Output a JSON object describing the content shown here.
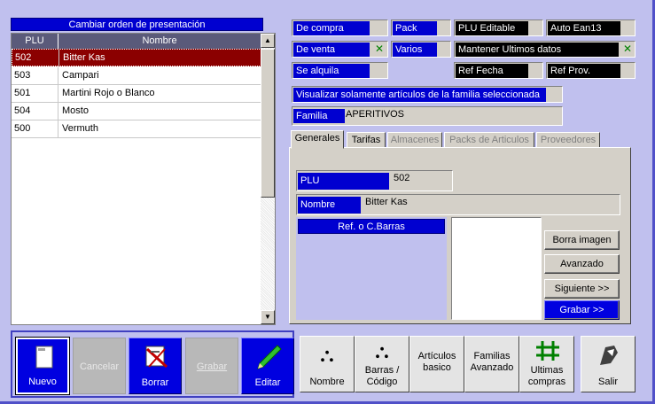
{
  "list": {
    "title": "Cambiar orden de presentación",
    "columns": [
      "PLU",
      "Nombre"
    ],
    "rows": [
      {
        "plu": "502",
        "nombre": "Bitter Kas",
        "selected": true
      },
      {
        "plu": "503",
        "nombre": "Campari"
      },
      {
        "plu": "501",
        "nombre": "Martini Rojo o Blanco"
      },
      {
        "plu": "504",
        "nombre": "Mosto"
      },
      {
        "plu": "500",
        "nombre": "Vermuth"
      }
    ]
  },
  "flags": {
    "de_compra": "De compra",
    "de_venta": "De venta",
    "se_alquila": "Se alquila",
    "pack": "Pack",
    "varios": "Varios",
    "plu_editable": "PLU Editable",
    "auto_ean13": "Auto Ean13",
    "mantener": "Mantener Ultimos datos",
    "ref_fecha": "Ref Fecha",
    "ref_prov": "Ref Prov.",
    "check": "✕"
  },
  "familia": {
    "visualizar": "Visualizar solamente artículos de la familia seleccionada",
    "label": "Familia",
    "value": "APERITIVOS"
  },
  "tabs": [
    "Generales",
    "Tarifas",
    "Almacenes",
    "Packs de Articulos",
    "Proveedores"
  ],
  "generales": {
    "plu_label": "PLU",
    "plu_value": "502",
    "nombre_label": "Nombre",
    "nombre_value": "Bitter Kas",
    "ref_label": "Ref. o C.Barras",
    "borra_imagen": "Borra imagen",
    "avanzado": "Avanzado",
    "siguiente": "Siguiente >>",
    "grabar": "Grabar >>"
  },
  "toolbar": {
    "nuevo": "Nuevo",
    "cancelar": "Cancelar",
    "borrar": "Borrar",
    "grabar": "Grabar",
    "editar": "Editar"
  },
  "actions": {
    "nombre": "Nombre",
    "barras_1": "Barras /",
    "barras_2": "Código",
    "articulos_1": "Artículos",
    "articulos_2": "basico",
    "familias_1": "Familias",
    "familias_2": "Avanzado",
    "ultimas_1": "Ultimas",
    "ultimas_2": "compras",
    "salir": "Salir"
  },
  "colors": {
    "accent": "#0000d0",
    "selected_row": "#8b0000",
    "background": "#c0c0ee"
  }
}
